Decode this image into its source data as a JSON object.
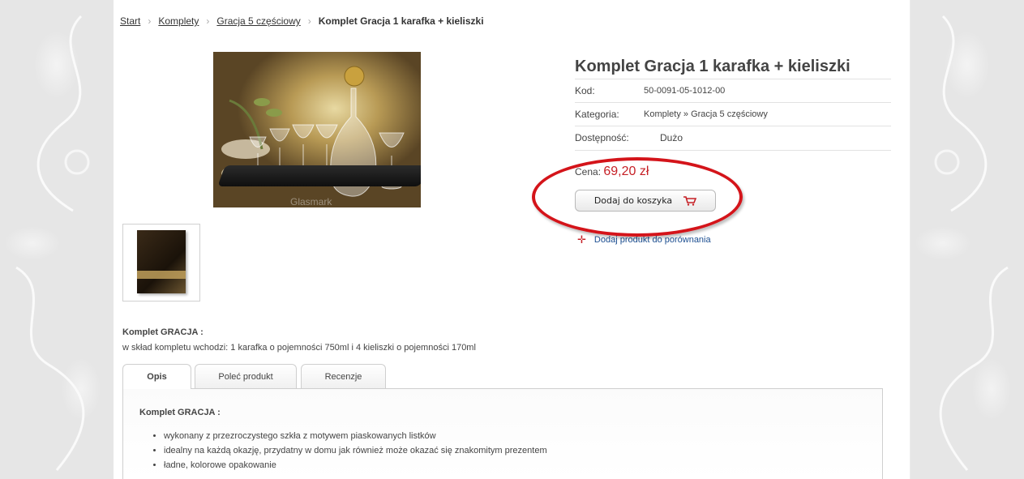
{
  "breadcrumb": {
    "items": [
      "Start",
      "Komplety",
      "Gracja 5 częściowy"
    ],
    "current": "Komplet Gracja 1 karafka + kieliszki"
  },
  "product": {
    "title": "Komplet Gracja 1 karafka + kieliszki",
    "image_watermark": "Glasmark",
    "details": [
      {
        "label": "Kod:",
        "value": "50-0091-05-1012-00"
      },
      {
        "label": "Kategoria:",
        "value": "Komplety » Gracja 5 częściowy"
      },
      {
        "label": "Dostępność:",
        "value": "Dużo"
      }
    ],
    "price_label": "Cena:",
    "price_value": "69,20 zł",
    "add_to_cart_label": "Dodaj do koszyka",
    "compare_label": "Dodaj produkt do porównania"
  },
  "description": {
    "heading": "Komplet GRACJA :",
    "text": "w skład kompletu wchodzi: 1 karafka o pojemności 750ml i 4 kieliszki o pojemności 170ml"
  },
  "tabs": [
    "Opis",
    "Poleć produkt",
    "Recenzje"
  ],
  "tab_panel": {
    "heading": "Komplet GRACJA :",
    "bullets": [
      "wykonany z przezroczystego szkła z motywem piaskowanych listków",
      "idealny na każdą okazję, przydatny w domu jak również może okazać się znakomitym prezentem",
      "ładne, kolorowe opakowanie"
    ]
  },
  "colors": {
    "price": "#c62026",
    "link": "#1d4f91",
    "highlight": "#d4141a"
  }
}
